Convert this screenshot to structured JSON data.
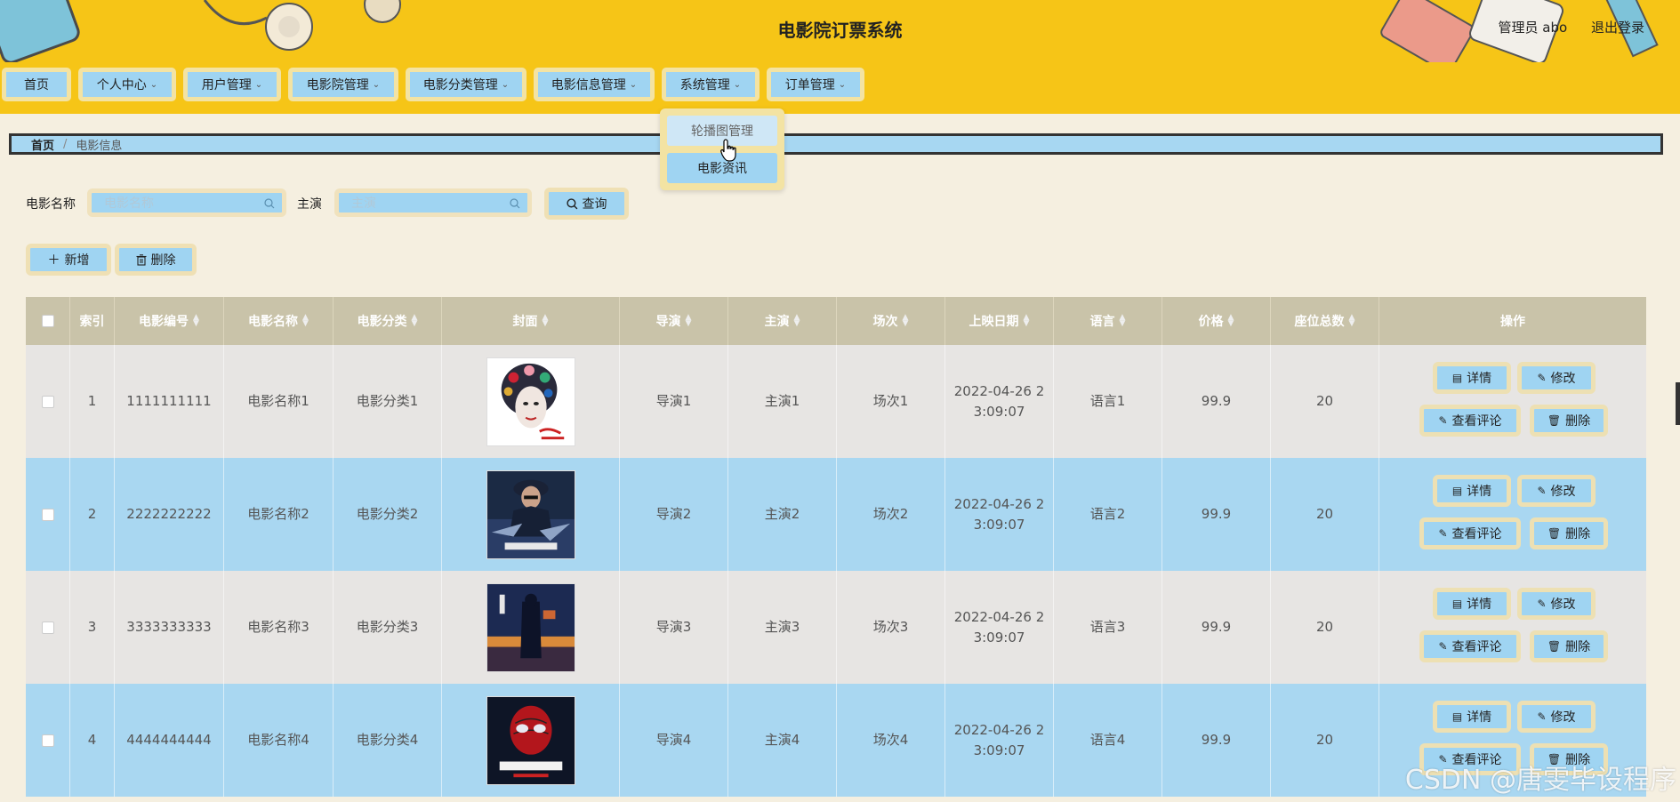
{
  "header": {
    "title": "电影院订票系统",
    "user_label": "管理员 abo",
    "logout_label": "退出登录"
  },
  "nav": {
    "items": [
      {
        "label": "首页",
        "has_dropdown": false
      },
      {
        "label": "个人中心",
        "has_dropdown": true
      },
      {
        "label": "用户管理",
        "has_dropdown": true
      },
      {
        "label": "电影院管理",
        "has_dropdown": true
      },
      {
        "label": "电影分类管理",
        "has_dropdown": true
      },
      {
        "label": "电影信息管理",
        "has_dropdown": true
      },
      {
        "label": "系统管理",
        "has_dropdown": true
      },
      {
        "label": "订单管理",
        "has_dropdown": true
      }
    ],
    "chevron": "⌄",
    "dropdown": {
      "items": [
        {
          "label": "轮播图管理"
        },
        {
          "label": "电影资讯"
        }
      ]
    }
  },
  "breadcrumb": {
    "home": "首页",
    "separator": "/",
    "current": "电影信息"
  },
  "search": {
    "name_label": "电影名称",
    "name_placeholder": "电影名称",
    "actor_label": "主演",
    "actor_placeholder": "主演",
    "query_label": "查询"
  },
  "actions": {
    "add_label": "新增",
    "delete_label": "删除"
  },
  "table": {
    "columns": [
      "索引",
      "电影编号",
      "电影名称",
      "电影分类",
      "封面",
      "导演",
      "主演",
      "场次",
      "上映日期",
      "语言",
      "价格",
      "座位总数",
      "操作"
    ],
    "rows": [
      {
        "index": "1",
        "code": "1111111111",
        "name": "电影名称1",
        "category": "电影分类1",
        "director": "导演1",
        "actor": "主演1",
        "session": "场次1",
        "date": "2022-04-26 2",
        "date2": "3:09:07",
        "language": "语言1",
        "price": "99.9",
        "seats": "20"
      },
      {
        "index": "2",
        "code": "2222222222",
        "name": "电影名称2",
        "category": "电影分类2",
        "director": "导演2",
        "actor": "主演2",
        "session": "场次2",
        "date": "2022-04-26 2",
        "date2": "3:09:07",
        "language": "语言2",
        "price": "99.9",
        "seats": "20"
      },
      {
        "index": "3",
        "code": "3333333333",
        "name": "电影名称3",
        "category": "电影分类3",
        "director": "导演3",
        "actor": "主演3",
        "session": "场次3",
        "date": "2022-04-26 2",
        "date2": "3:09:07",
        "language": "语言3",
        "price": "99.9",
        "seats": "20"
      },
      {
        "index": "4",
        "code": "4444444444",
        "name": "电影名称4",
        "category": "电影分类4",
        "director": "导演4",
        "actor": "主演4",
        "session": "场次4",
        "date": "2022-04-26 2",
        "date2": "3:09:07",
        "language": "语言4",
        "price": "99.9",
        "seats": "20"
      }
    ],
    "ops": {
      "detail": "详情",
      "edit": "修改",
      "comments": "查看评论",
      "delete": "删除"
    }
  },
  "watermark": "CSDN @唐雯毕设程序",
  "colors": {
    "header_bg": "#f6c517",
    "button_bg": "#9fd4f2",
    "button_border": "#f3e3a3",
    "page_bg": "#f5efe0",
    "table_head_bg": "#c9c3a9",
    "row_alt_bg": "#a9d7f1"
  }
}
